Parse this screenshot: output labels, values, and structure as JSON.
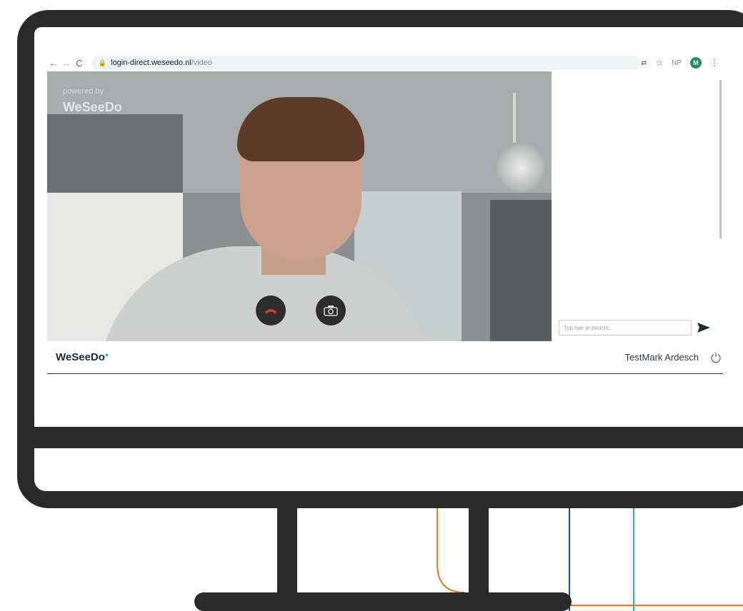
{
  "browser": {
    "url_host": "login-direct.weseedo.nl",
    "url_path": "/video",
    "profile_label": "NP",
    "avatar_letter": "M",
    "icons": [
      "back-icon",
      "forward-icon",
      "reload-icon",
      "lock-icon",
      "translate-icon",
      "star-icon",
      "menu-icon"
    ]
  },
  "video": {
    "powered_by": "powered by",
    "brand": "WeSeeDo"
  },
  "chat": {
    "input_placeholder": "Typ hier je bericht.."
  },
  "footer": {
    "logo": "WeSeeDo",
    "user_name": "TestMark Ardesch"
  },
  "colors": {
    "accent_green": "#19c37d",
    "monitor": "#2a2a2a",
    "line_navy": "#1d4f8c",
    "line_cyan": "#23a9e1",
    "line_orange": "#e8762b"
  }
}
